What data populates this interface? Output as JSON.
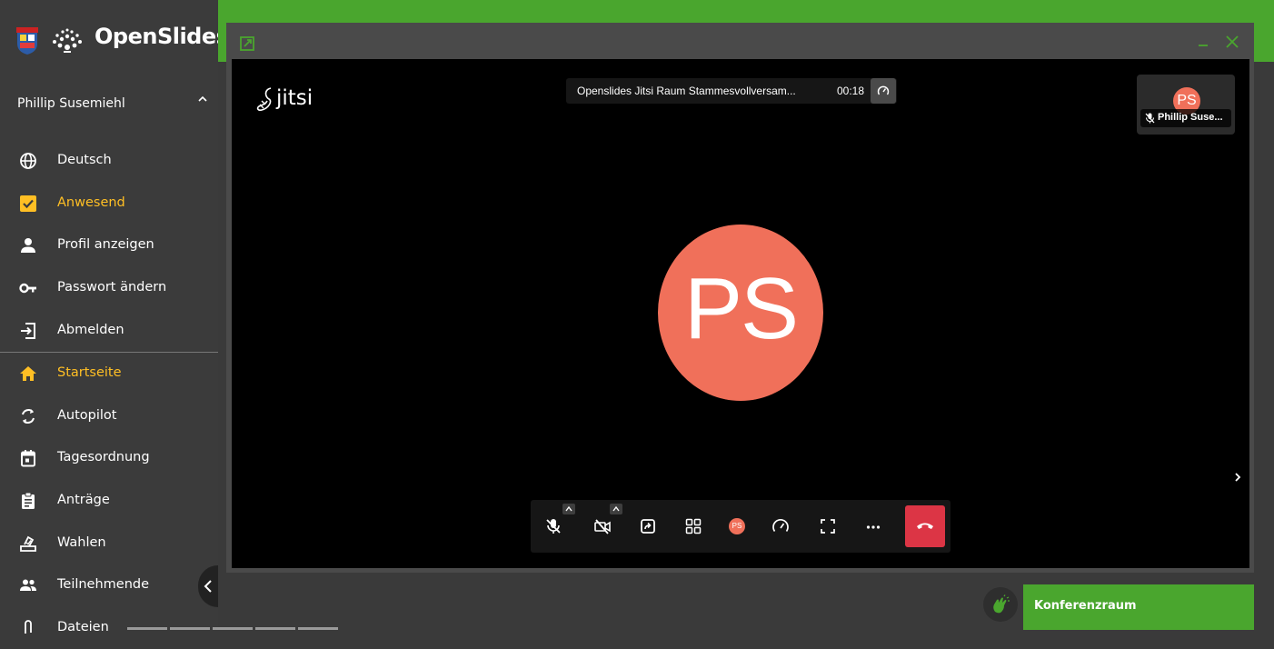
{
  "app": {
    "name": "OpenSlides"
  },
  "user": {
    "name": "Phillip Susemiehl"
  },
  "account_menu": [
    {
      "label": "Deutsch",
      "icon": "globe-icon"
    },
    {
      "label": "Anwesend",
      "icon": "checkbox-checked-icon",
      "active": true
    },
    {
      "label": "Profil anzeigen",
      "icon": "person-icon"
    },
    {
      "label": "Passwort ändern",
      "icon": "key-icon"
    },
    {
      "label": "Abmelden",
      "icon": "logout-icon"
    }
  ],
  "nav": [
    {
      "label": "Startseite",
      "icon": "home-icon",
      "active": true
    },
    {
      "label": "Autopilot",
      "icon": "sync-icon"
    },
    {
      "label": "Tagesordnung",
      "icon": "calendar-icon"
    },
    {
      "label": "Anträge",
      "icon": "clipboard-icon"
    },
    {
      "label": "Wahlen",
      "icon": "ballot-icon"
    },
    {
      "label": "Teilnehmende",
      "icon": "people-icon"
    },
    {
      "label": "Dateien",
      "icon": "attachment-icon"
    }
  ],
  "jitsi": {
    "logo_text": "jitsi",
    "room_title": "Openslides Jitsi Raum Stammesvollversam...",
    "elapsed": "00:18",
    "participant_thumbnail": {
      "initials": "PS",
      "name": "Phillip Suse..."
    },
    "main_avatar_initials": "PS",
    "toolbar_avatar_initials": "PS"
  },
  "bottom": {
    "conference_label": "Konferenzraum"
  },
  "colors": {
    "brand_green": "#4aa62e",
    "sidebar_bg": "#3b3b3b",
    "active_yellow": "#ffbf24",
    "avatar_coral": "#f0705a",
    "hangup_red": "#dc3545"
  }
}
